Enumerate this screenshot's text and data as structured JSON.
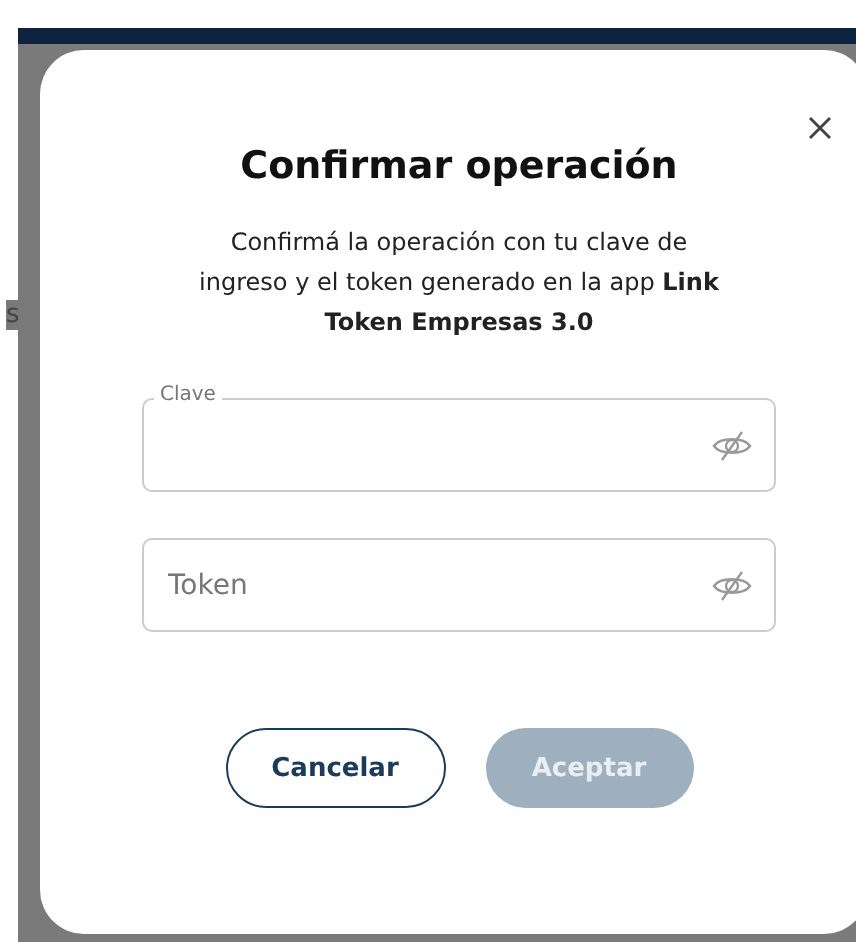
{
  "background": {
    "text_fragment": "s"
  },
  "dialog": {
    "title": "Confirmar operación",
    "message": "Confirmá la operación con tu clave de ingreso y el token generado en la app **Link Token Empresas 3.0**",
    "fields": [
      {
        "label": "Clave",
        "kind": "floating"
      },
      {
        "placeholder": "Token",
        "kind": "plain"
      }
    ],
    "buttons": [
      {
        "label": "Cancelar",
        "kind": "outline",
        "disabled": false
      },
      {
        "label": "Aceptar",
        "kind": "primary",
        "disabled": true
      }
    ]
  }
}
